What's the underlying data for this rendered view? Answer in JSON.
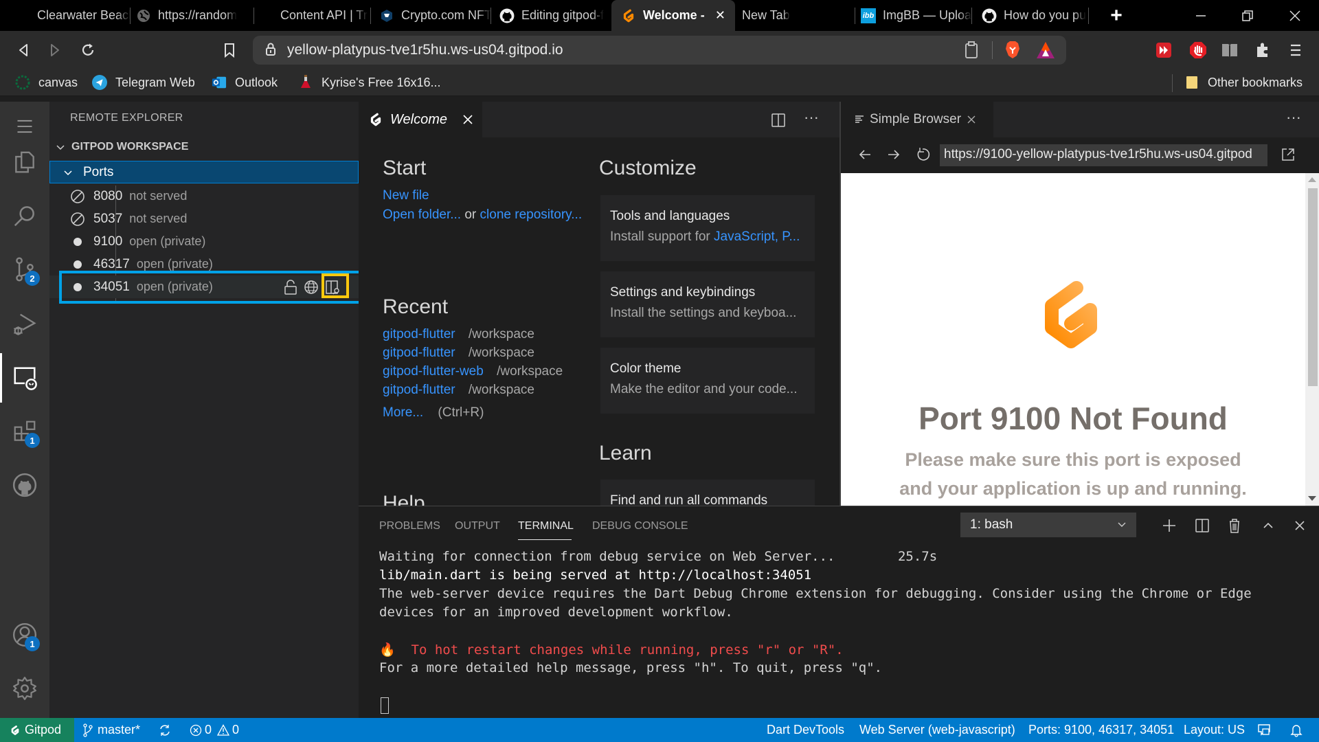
{
  "browser": {
    "tabs": [
      {
        "label": "Clearwater Beach",
        "icon": "globe-dark-icon"
      },
      {
        "label": "https://random",
        "icon": "globe-icon"
      },
      {
        "label": "Content API | Tr",
        "icon": "none"
      },
      {
        "label": "Crypto.com NFT",
        "icon": "crypto-com-icon"
      },
      {
        "label": "Editing gitpod-f",
        "icon": "github-icon"
      },
      {
        "label": "Welcome -",
        "icon": "gitpod-icon",
        "active": true
      },
      {
        "label": "New Tab",
        "icon": "none"
      },
      {
        "label": "ImgBB — Upload",
        "icon": "imgbb-icon"
      },
      {
        "label": "How do you pu",
        "icon": "github-icon"
      }
    ],
    "new_tab_symbol": "+",
    "close_tab_symbol": "✕",
    "url": "yellow-platypus-tve1r5hu.ws-us04.gitpod.io",
    "bookmarks": [
      {
        "label": "canvas",
        "icon": "canvas-icon"
      },
      {
        "label": "Telegram Web",
        "icon": "telegram-icon"
      },
      {
        "label": "Outlook",
        "icon": "outlook-icon"
      },
      {
        "label": "Kyrise's Free 16x16...",
        "icon": "potion-icon"
      }
    ],
    "other_bookmarks": "Other bookmarks"
  },
  "sidebar": {
    "title": "REMOTE EXPLORER",
    "section": "GITPOD WORKSPACE",
    "group": "Ports",
    "ports": [
      {
        "port": "8080",
        "status": "not served",
        "icon": "not-served-icon"
      },
      {
        "port": "5037",
        "status": "not served",
        "icon": "not-served-icon"
      },
      {
        "port": "9100",
        "status": "open (private)",
        "icon": "dot-icon"
      },
      {
        "port": "46317",
        "status": "open (private)",
        "icon": "dot-icon"
      },
      {
        "port": "34051",
        "status": "open (private)",
        "icon": "dot-icon"
      }
    ]
  },
  "activity": {
    "scm_badge": "2",
    "extensions_badge": "1",
    "accounts_badge": "1"
  },
  "welcome": {
    "tab_label": "Welcome",
    "start_heading": "Start",
    "new_file": "New file",
    "open_folder": "Open folder...",
    "or": "or",
    "clone_repo": "clone repository...",
    "recent_heading": "Recent",
    "recent": [
      {
        "name": "gitpod-flutter",
        "path": "/workspace"
      },
      {
        "name": "gitpod-flutter",
        "path": "/workspace"
      },
      {
        "name": "gitpod-flutter-web",
        "path": "/workspace"
      },
      {
        "name": "gitpod-flutter",
        "path": "/workspace"
      }
    ],
    "more": "More...",
    "more_shortcut": "(Ctrl+R)",
    "help_heading": "Help",
    "customize_heading": "Customize",
    "cards": [
      {
        "title": "Tools and languages",
        "desc_prefix": "Install support for ",
        "desc_link": "JavaScript, P..."
      },
      {
        "title": "Settings and keybindings",
        "desc_prefix": "Install the settings and keyboa...",
        "desc_link": ""
      },
      {
        "title": "Color theme",
        "desc_prefix": "Make the editor and your code...",
        "desc_link": ""
      }
    ],
    "learn_heading": "Learn",
    "learn_cards": [
      {
        "title": "Find and run all commands"
      }
    ]
  },
  "simple_browser": {
    "tab_label": "Simple Browser",
    "url": "https://9100-yellow-platypus-tve1r5hu.ws-us04.gitpod",
    "page_title": "Port 9100 Not Found",
    "page_line1": "Please make sure this port is exposed",
    "page_line2": "and your application is up and running."
  },
  "panel": {
    "tabs": [
      "PROBLEMS",
      "OUTPUT",
      "TERMINAL",
      "DEBUG CONSOLE"
    ],
    "active_tab": "TERMINAL",
    "terminal_select": "1: bash",
    "terminal_lines": [
      {
        "text": "Waiting for connection from debug service on Web Server...        25.7s",
        "color": "#d4d4d4",
        "bold": false
      },
      {
        "text": "lib/main.dart is being served at http://localhost:34051",
        "color": "#ffffff",
        "bold": true
      },
      {
        "text": "The web-server device requires the Dart Debug Chrome extension for debugging. Consider using the Chrome or Edge",
        "color": "#d4d4d4",
        "bold": false
      },
      {
        "text": "devices for an improved development workflow.",
        "color": "#d4d4d4",
        "bold": false
      },
      {
        "text": "",
        "color": "#d4d4d4",
        "bold": false
      },
      {
        "text": "🔥  To hot restart changes while running, press \"r\" or \"R\".",
        "color": "#f14c4c",
        "bold": true
      },
      {
        "text": "For a more detailed help message, press \"h\". To quit, press \"q\".",
        "color": "#d4d4d4",
        "bold": false
      }
    ]
  },
  "statusbar": {
    "remote": "Gitpod",
    "branch": "master*",
    "errors": "0",
    "warnings": "0",
    "dart_devtools": "Dart DevTools",
    "device": "Web Server (web-javascript)",
    "ports": "Ports: 9100, 46317, 34051",
    "layout": "Layout: US"
  },
  "colors": {
    "accent": "#007acc",
    "remote_status": "#16825d",
    "highlight_row": "#00a2e8",
    "highlight_action": "#ffc90e",
    "gitpod_orange": "#ff8a00"
  }
}
